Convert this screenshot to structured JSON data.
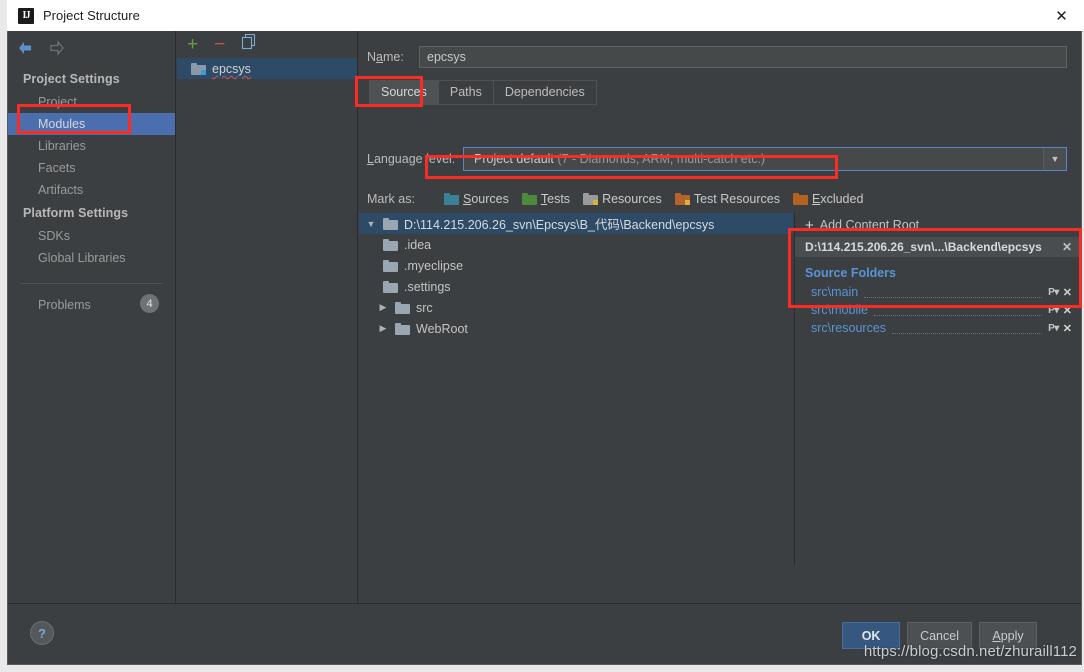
{
  "window": {
    "title": "Project Structure",
    "icon": "intellij-idea-icon",
    "close_label": "✕"
  },
  "sidebar": {
    "nav_back": "back-arrow",
    "nav_forward": "forward-arrow",
    "groups": [
      {
        "label": "Project Settings",
        "items": [
          {
            "label": "Project",
            "selected": false
          },
          {
            "label": "Modules",
            "selected": true
          },
          {
            "label": "Libraries",
            "selected": false
          },
          {
            "label": "Facets",
            "selected": false
          },
          {
            "label": "Artifacts",
            "selected": false
          }
        ]
      },
      {
        "label": "Platform Settings",
        "items": [
          {
            "label": "SDKs",
            "selected": false
          },
          {
            "label": "Global Libraries",
            "selected": false
          }
        ]
      }
    ],
    "problems": {
      "label": "Problems",
      "count": "4"
    }
  },
  "modules_panel": {
    "toolbar": {
      "add": "+",
      "remove": "−",
      "copy": "copy-icon"
    },
    "items": [
      {
        "label": "epcsys",
        "selected": true
      }
    ]
  },
  "main": {
    "name": {
      "label": "Name:",
      "value": "epcsys",
      "placeholder": ""
    },
    "tabs": [
      {
        "label": "Sources",
        "active": true
      },
      {
        "label": "Paths",
        "active": false
      },
      {
        "label": "Dependencies",
        "active": false
      }
    ],
    "language_level": {
      "label": "Language level:",
      "value_main": "Project default",
      "value_detail": "(7 - Diamonds, ARM, multi-catch etc.)"
    },
    "mark_as": {
      "label": "Mark as:",
      "options": [
        {
          "label": "Sources",
          "accesskey": "S",
          "color": "#3b8099"
        },
        {
          "label": "Tests",
          "accesskey": "T",
          "color": "#4e8a3b"
        },
        {
          "label": "Resources",
          "accesskey": "",
          "color": "#9b9b9b"
        },
        {
          "label": "Test Resources",
          "accesskey": "",
          "color": "#b5632a"
        },
        {
          "label": "Excluded",
          "accesskey": "E",
          "color": "#b3621f"
        }
      ]
    }
  },
  "tree": {
    "rows": [
      {
        "label": "D:\\114.215.206.26_svn\\Epcsys\\B_代码\\Backend\\epcsys",
        "indent": 0,
        "toggle": "▼",
        "selected": true
      },
      {
        "label": ".idea",
        "indent": 1,
        "toggle": "",
        "selected": false
      },
      {
        "label": ".myeclipse",
        "indent": 1,
        "toggle": "",
        "selected": false
      },
      {
        "label": ".settings",
        "indent": 1,
        "toggle": "",
        "selected": false
      },
      {
        "label": "src",
        "indent": 1,
        "toggle": "▶",
        "selected": false
      },
      {
        "label": "WebRoot",
        "indent": 1,
        "toggle": "▶",
        "selected": false
      }
    ]
  },
  "content_root_panel": {
    "add_content_root": "Add Content Root",
    "add_content_root_plus": "+",
    "root_path": "D:\\114.215.206.26_svn\\...\\Backend\\epcsys",
    "root_remove": "✕",
    "source_folders_title": "Source Folders",
    "source_folders": [
      {
        "path": "src\\main",
        "prefix_icon": "P",
        "remove": "✕"
      },
      {
        "path": "src\\mobile",
        "prefix_icon": "P",
        "remove": "✕"
      },
      {
        "path": "src\\resources",
        "prefix_icon": "P",
        "remove": "✕"
      }
    ]
  },
  "footer": {
    "help": "?",
    "ok": "OK",
    "cancel": "Cancel",
    "apply": "Apply",
    "watermark": "https://blog.csdn.net/zhuraill112"
  },
  "colors": {
    "accent_selection": "#4b6eaf",
    "tree_selection": "#2d4a66",
    "link_blue": "#5a93d6",
    "annotation_red": "#fb2c23",
    "primary_button": "#365880"
  }
}
